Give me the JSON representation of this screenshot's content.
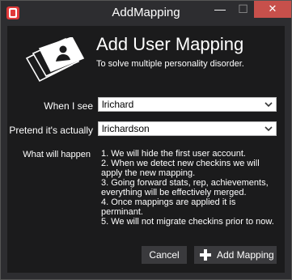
{
  "window": {
    "title": "AddMapping",
    "minimize_glyph": "—",
    "maximize_glyph": "☐",
    "close_glyph": "✕"
  },
  "header": {
    "heading": "Add User Mapping",
    "subheading": "To solve multiple personality disorder.",
    "icon": "user-cards-icon"
  },
  "form": {
    "when_i_see_label": "When I see",
    "when_i_see_value": "lrichard",
    "pretend_label": "Pretend it's actually",
    "pretend_value": "lrichardson",
    "what_will_happen_label": "What will happen",
    "steps": [
      "1. We will hide the first user account.",
      "2. When we detect new checkins we will",
      "apply the new mapping.",
      "3. Going forward stats, rep, achievements,",
      "everything will be effectively merged.",
      "4. Once mappings are applied it is perminant.",
      "5. We will not migrate checkins prior to now."
    ]
  },
  "buttons": {
    "cancel": "Cancel",
    "add_mapping": "Add Mapping"
  },
  "colors": {
    "window_bg": "#2d2d30",
    "content_bg": "#1b1b1c",
    "close_button": "#c7504b",
    "app_icon": "#e03a3a"
  }
}
